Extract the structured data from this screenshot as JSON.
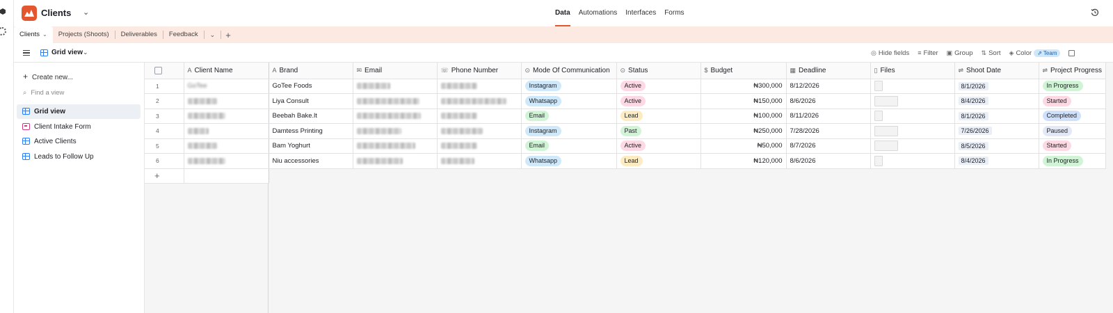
{
  "base": {
    "title": "Clients"
  },
  "top_nav": [
    {
      "label": "Data",
      "active": true
    },
    {
      "label": "Automations",
      "active": false
    },
    {
      "label": "Interfaces",
      "active": false
    },
    {
      "label": "Forms",
      "active": false
    }
  ],
  "table_tabs": {
    "active": "Clients",
    "others": [
      "Projects (Shoots)",
      "Deliverables",
      "Feedback"
    ]
  },
  "view_bar": {
    "view_name": "Grid view",
    "tools": {
      "hide_fields": "Hide fields",
      "filter": "Filter",
      "group": "Group",
      "sort": "Sort",
      "color": "Color",
      "team_pill": "Team"
    }
  },
  "sidebar": {
    "create_new": "Create new...",
    "find_placeholder": "Find a view",
    "views": [
      {
        "label": "Grid view",
        "type": "grid",
        "active": true
      },
      {
        "label": "Client Intake Form",
        "type": "form",
        "active": false
      },
      {
        "label": "Active Clients",
        "type": "grid",
        "active": false
      },
      {
        "label": "Leads to Follow Up",
        "type": "grid",
        "active": false
      }
    ]
  },
  "grid": {
    "columns": {
      "client_name": "Client Name",
      "brand": "Brand",
      "email": "Email",
      "phone": "Phone Number",
      "mode": "Mode Of Communication",
      "status": "Status",
      "budget": "Budget",
      "deadline": "Deadline",
      "files": "Files",
      "shoot_date": "Shoot Date",
      "progress": "Project Progress"
    },
    "rows": [
      {
        "num": "1",
        "client": "GoTee",
        "brand": "GoTee Foods",
        "mode": "Instagram",
        "status": "Active",
        "budget": "₦300,000",
        "deadline": "8/12/2026",
        "shoot": "8/1/2026",
        "progress": "In Progress"
      },
      {
        "num": "2",
        "client": "",
        "brand": "Liya Consult",
        "mode": "Whatsapp",
        "status": "Active",
        "budget": "₦150,000",
        "deadline": "8/6/2026",
        "shoot": "8/4/2026",
        "progress": "Started"
      },
      {
        "num": "3",
        "client": "",
        "brand": "Beebah Bake.lt",
        "mode": "Email",
        "status": "Lead",
        "budget": "₦100,000",
        "deadline": "8/11/2026",
        "shoot": "8/1/2026",
        "progress": "Completed"
      },
      {
        "num": "4",
        "client": "",
        "brand": "Damtess Printing",
        "mode": "Instagram",
        "status": "Past",
        "budget": "₦250,000",
        "deadline": "7/28/2026",
        "shoot": "7/26/2026",
        "progress": "Paused"
      },
      {
        "num": "5",
        "client": "",
        "brand": "Bam Yoghurt",
        "mode": "Email",
        "status": "Active",
        "budget": "₦50,000",
        "deadline": "8/7/2026",
        "shoot": "8/5/2026",
        "progress": "Started"
      },
      {
        "num": "6",
        "client": "",
        "brand": "Niu accessories",
        "mode": "Whatsapp",
        "status": "Lead",
        "budget": "₦120,000",
        "deadline": "8/6/2026",
        "shoot": "8/4/2026",
        "progress": "In Progress"
      }
    ]
  },
  "colors": {
    "brand": "#e4572e",
    "tabs_bg": "#fbe9e2",
    "mode": {
      "Instagram": "#cfe9fb",
      "Whatsapp": "#cfe9fb",
      "Email": "#d1f3d6"
    },
    "status": {
      "Active": "#fdd9e3",
      "Lead": "#fdecc2",
      "Past": "#d1f3d6"
    },
    "progress": {
      "In Progress": "#d1f3d6",
      "Started": "#fdd9e3",
      "Completed": "#cfe0fb",
      "Paused": "#e2e8f5"
    }
  }
}
